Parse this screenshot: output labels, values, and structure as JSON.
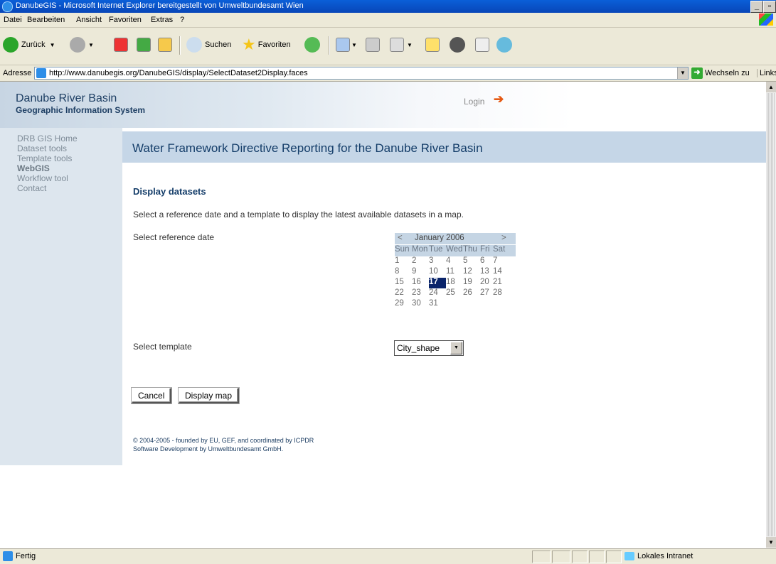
{
  "window": {
    "title": "DanubeGIS - Microsoft Internet Explorer bereitgestellt von Umweltbundesamt Wien"
  },
  "menu": [
    "Datei",
    "Bearbeiten",
    "Ansicht",
    "Favoriten",
    "Extras",
    "?"
  ],
  "toolbar": {
    "back_label": "Zurück",
    "search_label": "Suchen",
    "favorites_label": "Favoriten"
  },
  "address": {
    "label": "Adresse",
    "url": "http://www.danubegis.org/DanubeGIS/display/SelectDataset2Display.faces",
    "go_label": "Wechseln zu",
    "links_label": "Links"
  },
  "site": {
    "title": "Danube River Basin",
    "subtitle": "Geographic Information System",
    "login": "Login"
  },
  "nav": [
    {
      "label": "DRB GIS Home",
      "active": false
    },
    {
      "label": "Dataset tools",
      "active": false
    },
    {
      "label": "Template tools",
      "active": false
    },
    {
      "label": "WebGIS",
      "active": true
    },
    {
      "label": "Workflow tool",
      "active": false
    },
    {
      "label": "Contact",
      "active": false
    }
  ],
  "banner": {
    "title": "Water Framework Directive Reporting for the Danube River Basin"
  },
  "content": {
    "section_title": "Display datasets",
    "intro": "Select a reference date and a template to display the latest available datasets in a map.",
    "date_label": "Select reference date",
    "template_label": "Select template",
    "template_value": "City_shape",
    "cancel_label": "Cancel",
    "display_label": "Display map"
  },
  "calendar": {
    "prev": "<",
    "next": ">",
    "month": "January 2006",
    "weekdays": [
      "Sun",
      "Mon",
      "Tue",
      "Wed",
      "Thu",
      "Fri",
      "Sat"
    ],
    "weeks": [
      [
        "1",
        "2",
        "3",
        "4",
        "5",
        "6",
        "7"
      ],
      [
        "8",
        "9",
        "10",
        "11",
        "12",
        "13",
        "14"
      ],
      [
        "15",
        "16",
        "17",
        "18",
        "19",
        "20",
        "21"
      ],
      [
        "22",
        "23",
        "24",
        "25",
        "26",
        "27",
        "28"
      ],
      [
        "29",
        "30",
        "31",
        "",
        "",
        "",
        ""
      ]
    ],
    "selected": "17"
  },
  "footer": {
    "line1": "© 2004-2005 - founded by EU, GEF, and coordinated by ICPDR",
    "line2": "Software Development by Umweltbundesamt GmbH."
  },
  "status": {
    "text": "Fertig",
    "zone": "Lokales Intranet"
  }
}
